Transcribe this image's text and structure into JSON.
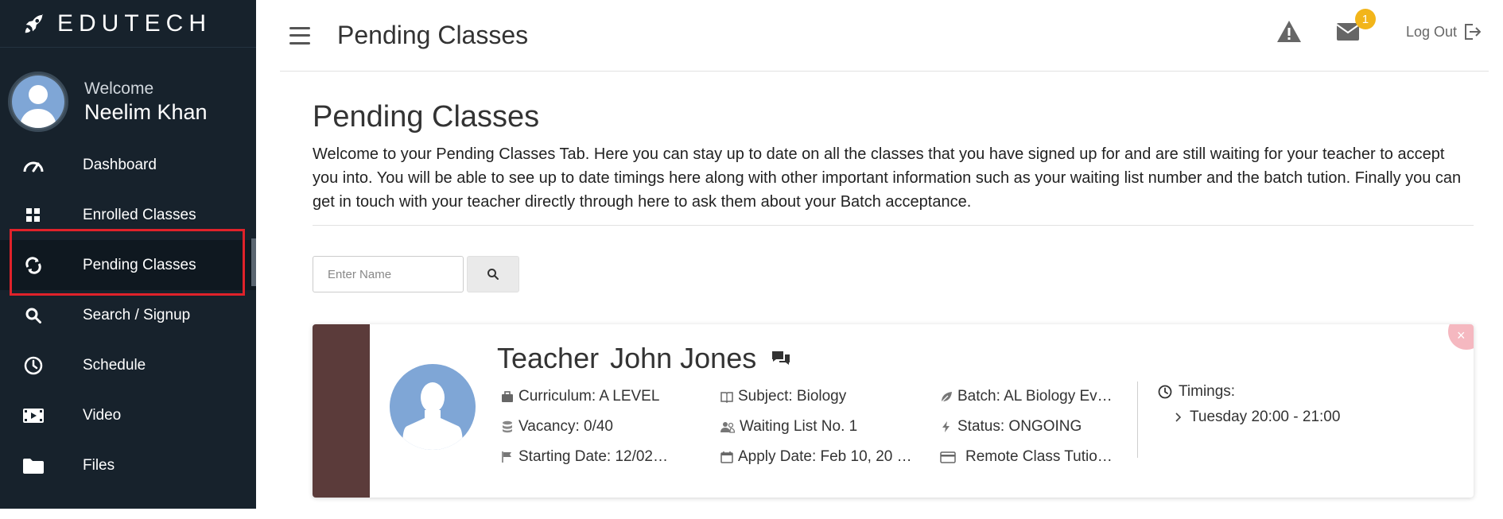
{
  "brand": {
    "name": "EDUTECH"
  },
  "user": {
    "welcome": "Welcome",
    "name": "Neelim Khan"
  },
  "sidebar": {
    "items": [
      {
        "label": "Dashboard",
        "icon": "speedometer-icon"
      },
      {
        "label": "Enrolled Classes",
        "icon": "grid-icon"
      },
      {
        "label": "Pending Classes",
        "icon": "refresh-icon",
        "active": true
      },
      {
        "label": "Search / Signup",
        "icon": "search-icon"
      },
      {
        "label": "Schedule",
        "icon": "clock-icon"
      },
      {
        "label": "Video",
        "icon": "video-icon"
      },
      {
        "label": "Files",
        "icon": "folder-icon"
      }
    ]
  },
  "topbar": {
    "title": "Pending Classes",
    "notification_count": "1",
    "logout_label": "Log Out"
  },
  "main": {
    "heading": "Pending Classes",
    "description": "Welcome to your Pending Classes Tab. Here you can stay up to date on all the classes that you have signed up for and are still waiting for your teacher to accept you into. You will be able to see up to date timings here along with other important information such as your waiting list number and the batch tution. Finally you can get in touch with your teacher directly through here to ask them about your Batch acceptance.",
    "search_placeholder": "Enter Name"
  },
  "card": {
    "teacher_prefix": "Teacher",
    "teacher_name": "John Jones",
    "curriculum": "Curriculum: A LEVEL",
    "subject": "Subject: Biology",
    "batch": "Batch: AL Biology Ev…",
    "vacancy": "Vacancy: 0/40",
    "waiting_list": "Waiting List No. 1",
    "status": "Status: ONGOING",
    "starting_date": "Starting Date: 12/02…",
    "apply_date": "Apply Date: Feb 10, 20 …",
    "class_type": "Remote Class Tutio…",
    "timings_label": "Timings:",
    "timings": [
      "Tuesday 20:00 - 21:00"
    ],
    "close_label": "×"
  },
  "colors": {
    "sidebar_bg": "#17222c",
    "active_outline": "#e0222a",
    "card_stripe": "#5b3b3a",
    "avatar": "#7fa6d6",
    "badge": "#f2b51a"
  }
}
